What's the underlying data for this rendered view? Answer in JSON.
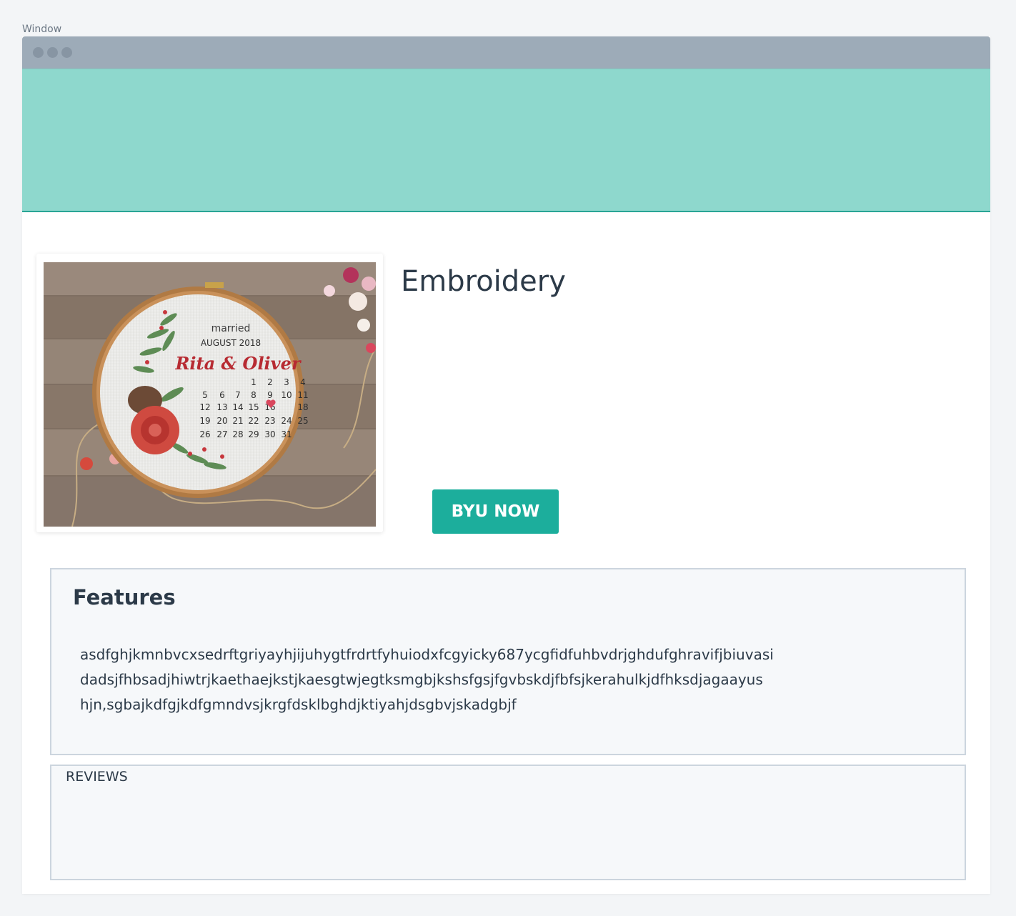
{
  "window": {
    "label": "Window"
  },
  "product": {
    "title": "Embroidery",
    "buy_label": "BYU NOW"
  },
  "image": {
    "married": "married",
    "month": "AUGUST 2018",
    "names": "Rita & Oliver",
    "calendar_rows": [
      [
        "",
        "",
        "",
        "",
        "1",
        "2",
        "3",
        "4"
      ],
      [
        "5",
        "6",
        "7",
        "8",
        "9",
        "10",
        "11"
      ],
      [
        "12",
        "13",
        "14",
        "15",
        "16",
        "",
        "18"
      ],
      [
        "19",
        "20",
        "21",
        "22",
        "23",
        "24",
        "25"
      ],
      [
        "26",
        "27",
        "28",
        "29",
        "30",
        "31"
      ]
    ]
  },
  "features": {
    "heading": "Features",
    "lines": [
      "asdfghjkmnbvcxsedrftgriyayhjijuhygtfrdrtfyhuiodxfcgyicky687ycgfidfuhbvdrjghdufghravifjbiuvasi",
      "dadsjfhbsadjhiwtrjkaethaejkstjkaesgtwjegtksmgbjkshsfgsjfgvbskdjfbfsjkerahulkjdfhksdjagaayus",
      "hjn,sgbajkdfgjkdfgmndvsjkrgfdsklbghdjktiyahjdsgbvjskadgbjf"
    ]
  },
  "reviews": {
    "label": "REVIEWS"
  },
  "colors": {
    "banner": "#8ed8cd",
    "accent": "#1cae9c",
    "titlebar": "#9dabb8"
  }
}
